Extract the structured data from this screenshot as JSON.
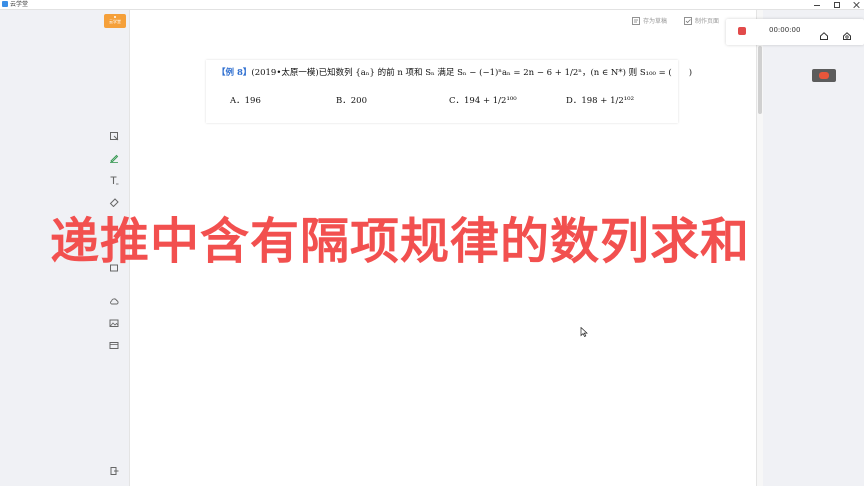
{
  "window": {
    "app_name": "云学堂"
  },
  "toolbar": {
    "logo_label": "云学堂",
    "save_board_label": "存为草稿",
    "make_page_label": "制作页面"
  },
  "left_tools": [
    "select-tool",
    "pen-tool",
    "text-tool",
    "eraser-tool",
    "shape-tool",
    "cloud-tool",
    "image-tool",
    "box-tool"
  ],
  "recorder": {
    "time": "00:00:00"
  },
  "question": {
    "tag": "【例 8】",
    "text": "(2019•太原一模)已知数列 {aₙ} 的前 n 项和 Sₙ 满足 Sₙ − (−1)ⁿaₙ = 2n − 6 + 1/2ⁿ，(n ∈ N*) 则 S₁₀₀ = (　　)",
    "options": [
      {
        "label": "A．",
        "value": "196"
      },
      {
        "label": "B．",
        "value": "200"
      },
      {
        "label": "C．",
        "value": "194 + 1/2¹⁰⁰"
      },
      {
        "label": "D．",
        "value": "198 + 1/2¹⁰²"
      }
    ]
  },
  "headline": "递推中含有隔项规律的数列求和",
  "colors": {
    "headline": "#f2504f",
    "tag": "#2f6fd0",
    "record": "#e24a4a",
    "logo": "#f5a03a"
  }
}
